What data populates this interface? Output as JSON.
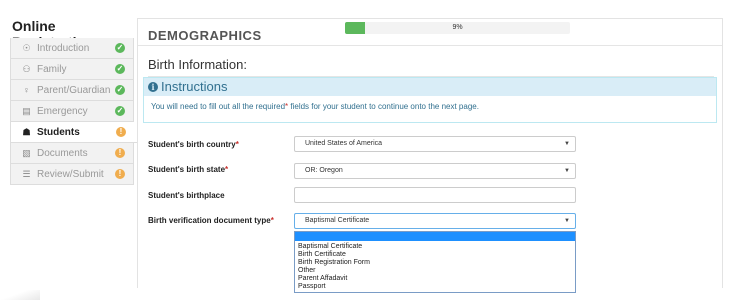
{
  "sidebar": {
    "title": "Online Registration",
    "items": [
      {
        "label": "Introduction",
        "icon": "lightbulb-icon",
        "glyph": "☉",
        "status": "check",
        "status_glyph": "✓"
      },
      {
        "label": "Family",
        "icon": "users-icon",
        "glyph": "⚇",
        "status": "check",
        "status_glyph": "✓"
      },
      {
        "label": "Parent/Guardian",
        "icon": "user-icon",
        "glyph": "♀",
        "status": "check",
        "status_glyph": "✓"
      },
      {
        "label": "Emergency",
        "icon": "id-card-icon",
        "glyph": "▤",
        "status": "check",
        "status_glyph": "✓"
      },
      {
        "label": "Students",
        "icon": "graduation-cap-icon",
        "glyph": "☗",
        "status": "warning",
        "status_glyph": "!"
      },
      {
        "label": "Documents",
        "icon": "document-icon",
        "glyph": "▧",
        "status": "warning",
        "status_glyph": "!"
      },
      {
        "label": "Review/Submit",
        "icon": "list-icon",
        "glyph": "☰",
        "status": "warning",
        "status_glyph": "!"
      }
    ]
  },
  "header": {
    "section_title": "DEMOGRAPHICS",
    "progress_label": "9%",
    "progress_value": 0.09
  },
  "birth_info": {
    "title": "Birth Information:"
  },
  "instructions": {
    "title": "Instructions",
    "text_before": "You will need to fill out all the required",
    "required_mark": "*",
    "text_after": " fields for your student to continue onto the next page."
  },
  "form": {
    "required_mark": "*",
    "birth_country": {
      "label": "Student's birth country",
      "value": "United States of America"
    },
    "birth_state": {
      "label": "Student's birth state",
      "value": "OR: Oregon"
    },
    "birthplace": {
      "label": "Student's birthplace",
      "value": ""
    },
    "verification_doc": {
      "label": "Birth verification document type",
      "value": "Baptismal Certificate",
      "options": [
        "Baptismal Certificate",
        "Birth Certificate",
        "Birth Registration Form",
        "Other",
        "Parent Affadavit",
        "Passport"
      ]
    },
    "caret_glyph": "▼"
  },
  "colors": {
    "success": "#5cb85c",
    "warning": "#f0ad4e",
    "info_bg": "#d9edf7",
    "info_text": "#31708f",
    "highlight": "#1e90ff"
  }
}
